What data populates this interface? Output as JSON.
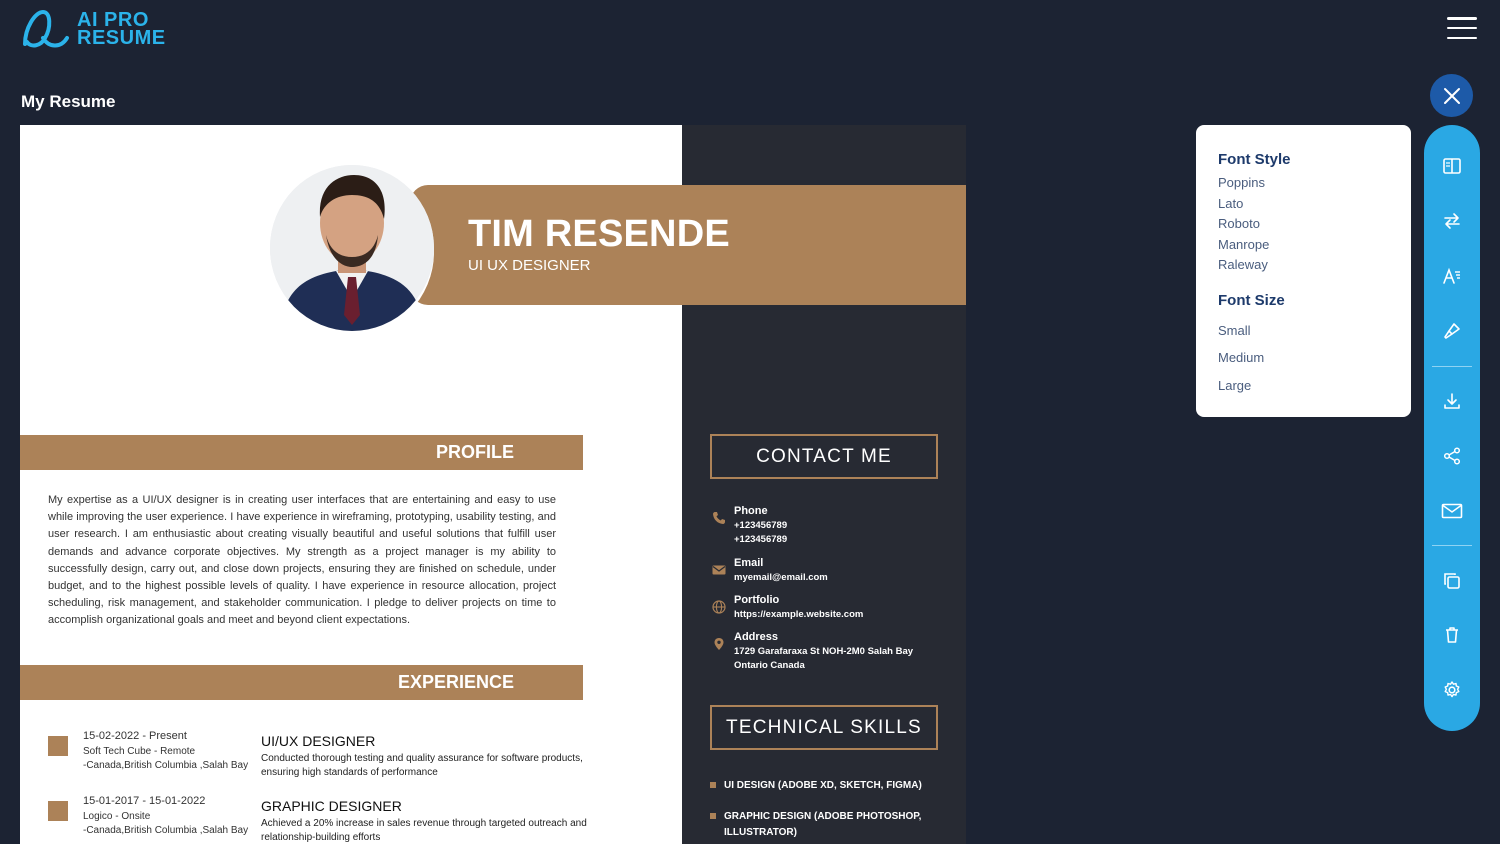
{
  "header": {
    "logo_line1": "AI PRO",
    "logo_line2": "RESUME",
    "menu_icon": "hamburger-icon"
  },
  "page": {
    "title": "My Resume"
  },
  "resume": {
    "name": "TIM RESENDE",
    "job_title": "UI UX DESIGNER",
    "profile_heading": "PROFILE",
    "profile_text": "My expertise as a UI/UX designer is in creating user interfaces that are entertaining and easy to use while improving the user experience. I have experience in wireframing, prototyping, usability testing, and user research. I am enthusiastic about creating visually beautiful and useful solutions that fulfill user demands and advance corporate objectives. My strength as a project manager is my ability to successfully design, carry out, and close down projects, ensuring they are finished on schedule, under budget, and to the highest possible levels of quality. I have experience in resource allocation, project scheduling, risk management, and stakeholder communication. I pledge to deliver projects on time to accomplish organizational goals and meet and beyond client expectations.",
    "experience_heading": "EXPERIENCE",
    "experience": [
      {
        "date": "15-02-2022 - Present",
        "company": "Soft Tech Cube - Remote",
        "location": "-Canada,British Columbia ,Salah Bay",
        "role": "UI/UX DESIGNER",
        "description": "Conducted thorough testing and quality assurance for software products, ensuring high standards of performance"
      },
      {
        "date": "15-01-2017 - 15-01-2022",
        "company": "Logico - Onsite",
        "location": "-Canada,British Columbia ,Salah Bay",
        "role": "GRAPHIC DESIGNER",
        "description": "Achieved a 20% increase in sales revenue through targeted outreach and relationship-building efforts"
      }
    ],
    "contact_heading": "CONTACT ME",
    "contact": [
      {
        "label": "Phone",
        "value": "+123456789\n+123456789",
        "icon": "phone-icon"
      },
      {
        "label": "Email",
        "value": "myemail@email.com",
        "icon": "mail-icon"
      },
      {
        "label": "Portfolio",
        "value": "https://example.website.com",
        "icon": "globe-icon"
      },
      {
        "label": "Address",
        "value": "1729 Garafaraxa St NOH-2M0 Salah Bay\nOntario Canada",
        "icon": "location-pin-icon"
      }
    ],
    "skills_heading": "TECHNICAL SKILLS",
    "skills": [
      "UI DESIGN (ADOBE XD, SKETCH, FIGMA)",
      "GRAPHIC DESIGN (ADOBE PHOTOSHOP, ILLUSTRATOR)"
    ],
    "accent_color": "#ac8258",
    "dark_color": "#272a33"
  },
  "font_panel": {
    "style_heading": "Font Style",
    "styles": [
      "Poppins",
      "Lato",
      "Roboto",
      "Manrope",
      "Raleway"
    ],
    "size_heading": "Font Size",
    "sizes": [
      "Small",
      "Medium",
      "Large"
    ]
  },
  "toolbar": {
    "close_icon": "close-icon",
    "items": [
      "layout-icon",
      "swap-icon",
      "font-icon",
      "paint-brush-icon",
      "download-icon",
      "share-icon",
      "email-icon",
      "duplicate-icon",
      "delete-icon",
      "settings-icon"
    ],
    "color": "#2aa8e4"
  }
}
